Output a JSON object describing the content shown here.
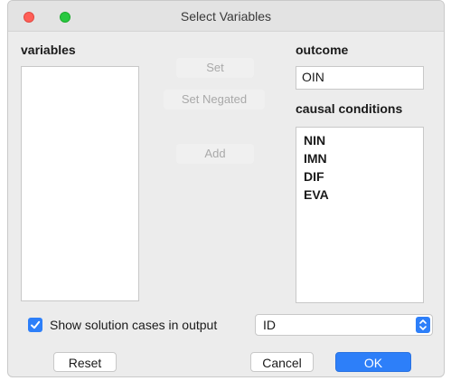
{
  "window": {
    "title": "Select Variables"
  },
  "left": {
    "label": "variables",
    "items": []
  },
  "middle": {
    "set_label": "Set",
    "set_negated_label": "Set Negated",
    "add_label": "Add"
  },
  "right": {
    "outcome_label": "outcome",
    "outcome_value": "OIN",
    "causal_label": "causal conditions",
    "causal_items": [
      "NIN",
      "IMN",
      "DIF",
      "EVA"
    ]
  },
  "footer": {
    "show_solution_label": "Show solution cases in output",
    "show_solution_checked": true,
    "id_select_value": "ID",
    "reset_label": "Reset",
    "cancel_label": "Cancel",
    "ok_label": "OK"
  },
  "colors": {
    "accent": "#2d7ff9",
    "close": "#ff5f57",
    "zoom": "#28c840"
  }
}
